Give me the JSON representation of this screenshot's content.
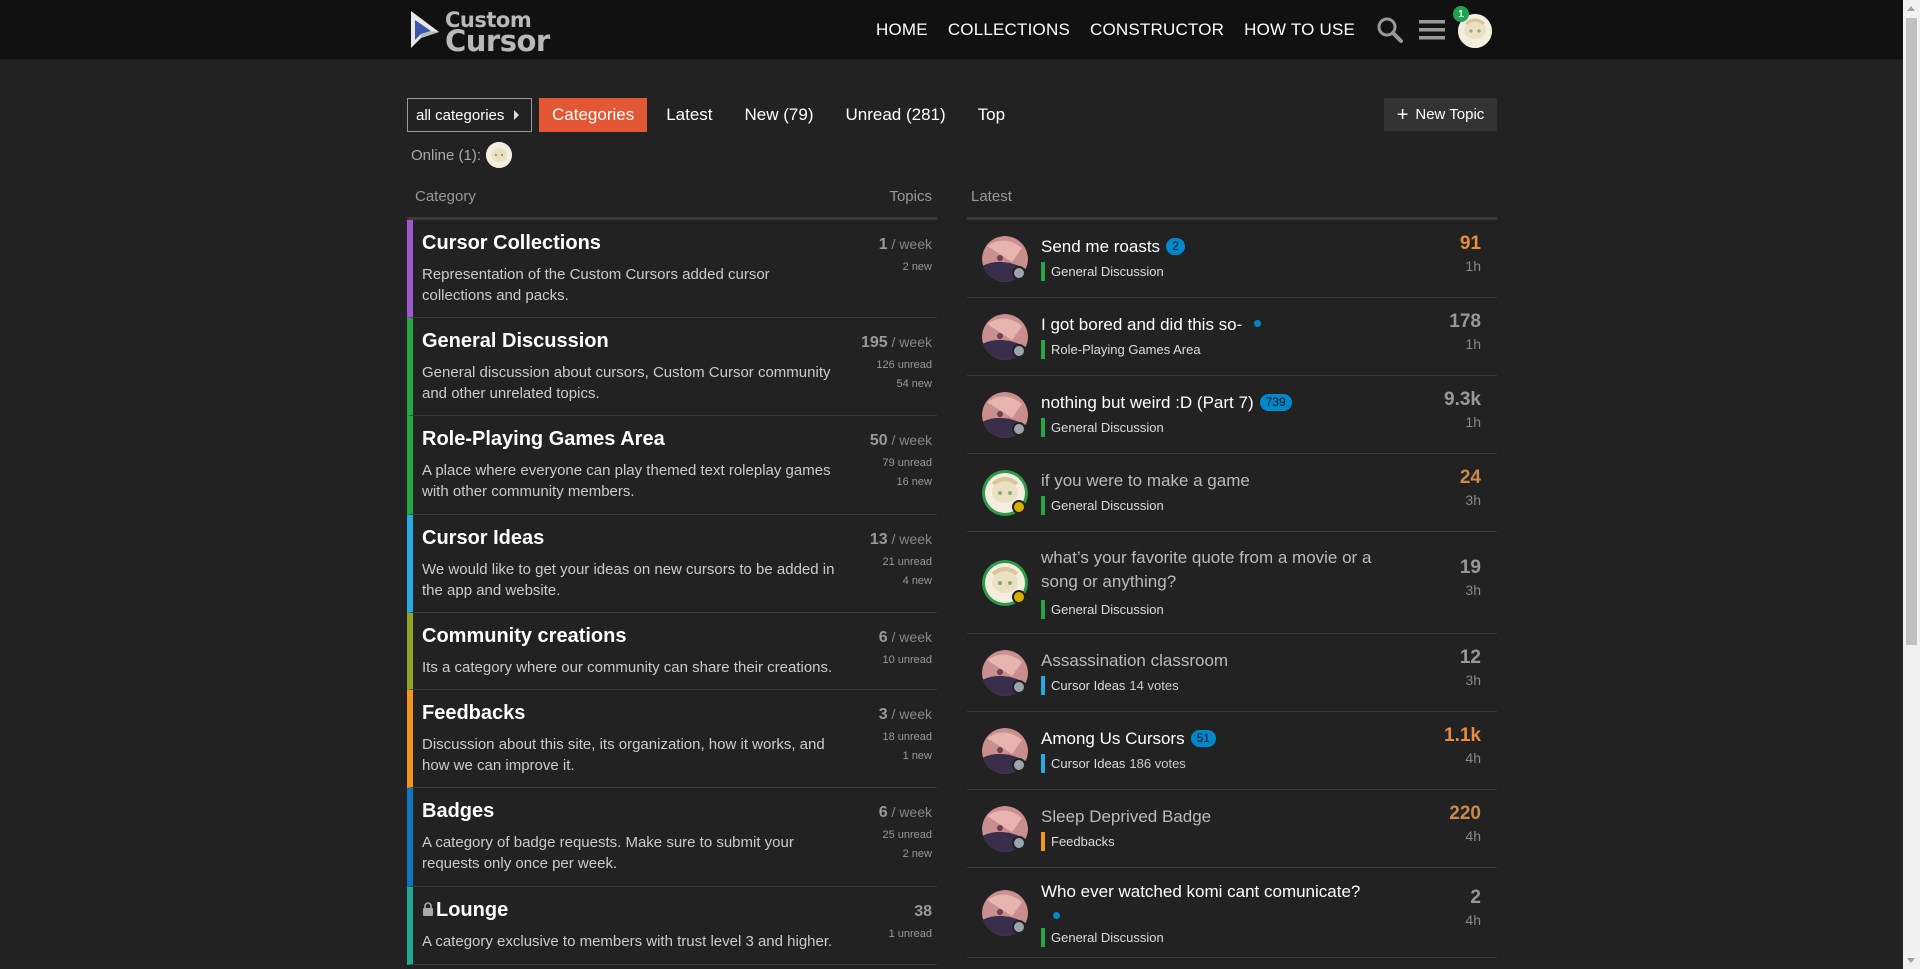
{
  "header": {
    "logo_alt": "Custom Cursor",
    "nav": [
      "HOME",
      "COLLECTIONS",
      "CONSTRUCTOR",
      "HOW TO USE"
    ],
    "notification_count": "1"
  },
  "toolbar": {
    "dropdown_label": "all categories",
    "tabs": [
      "Categories",
      "Latest",
      "New (79)",
      "Unread (281)",
      "Top"
    ],
    "new_topic_label": "New Topic"
  },
  "online_label": "Online (1):",
  "categories_header": {
    "category": "Category",
    "topics": "Topics"
  },
  "latest_header": "Latest",
  "categories": [
    {
      "name": "Cursor Collections",
      "description": "Representation of the Custom Cursors added cursor collections and packs.",
      "count": "1",
      "period": " / week",
      "sub1": "2 new",
      "sub2": "",
      "color": "#9e58ce",
      "locked": false
    },
    {
      "name": "General Discussion",
      "description": "General discussion about cursors, Custom Cursor community and other unrelated topics.",
      "count": "195",
      "period": " / week",
      "sub1": "126 unread",
      "sub2": "54 new",
      "color": "#27a744",
      "locked": false
    },
    {
      "name": "Role-Playing Games Area",
      "description": "A place where everyone can play themed text roleplay games with other community members.",
      "count": "50",
      "period": " / week",
      "sub1": "79 unread",
      "sub2": "16 new",
      "color": "#27a744",
      "locked": false
    },
    {
      "name": "Cursor Ideas",
      "description": "We would like to get your ideas on new cursors to be added in the app and website.",
      "count": "13",
      "period": " / week",
      "sub1": "21 unread",
      "sub2": "4 new",
      "color": "#25aae1",
      "locked": false
    },
    {
      "name": "Community creations",
      "description": "Its a category where our community can share their creations.",
      "count": "6",
      "period": " / week",
      "sub1": "10 unread",
      "sub2": "",
      "color": "#92a32a",
      "locked": false
    },
    {
      "name": "Feedbacks",
      "description": "Discussion about this site, its organization, how it works, and how we can improve it.",
      "count": "3",
      "period": " / week",
      "sub1": "18 unread",
      "sub2": "1 new",
      "color": "#f7941d",
      "locked": false
    },
    {
      "name": "Badges",
      "description": "A category of badge requests. Make sure to submit your requests only once per week.",
      "count": "6",
      "period": " / week",
      "sub1": "25 unread",
      "sub2": "2 new",
      "color": "#0e76bd",
      "locked": false
    },
    {
      "name": "Lounge",
      "description": "A category exclusive to members with trust level 3 and higher.",
      "count": "38",
      "period": "",
      "sub1": "1 unread",
      "sub2": "",
      "color": "#1fa98e",
      "locked": true
    }
  ],
  "topics": [
    {
      "title": "Send me roasts",
      "badge": "2",
      "dot": false,
      "read": false,
      "category": "General Discussion",
      "cat_color": "#27a744",
      "votes": "",
      "replies": "91",
      "replies_color": "#e68d3e",
      "age": "1h",
      "avatar": "pink"
    },
    {
      "title": "I got bored and did this so-",
      "badge": "",
      "dot": true,
      "read": false,
      "category": "Role-Playing Games Area",
      "cat_color": "#27a744",
      "votes": "",
      "replies": "178",
      "replies_color": "#999999",
      "age": "1h",
      "avatar": "pink"
    },
    {
      "title": "nothing but weird :D (Part 7)",
      "badge": "739",
      "dot": false,
      "read": false,
      "category": "General Discussion",
      "cat_color": "#27a744",
      "votes": "",
      "replies": "9.3k",
      "replies_color": "#999999",
      "age": "1h",
      "avatar": "pink"
    },
    {
      "title": "if you were to make a game",
      "badge": "",
      "dot": false,
      "read": true,
      "category": "General Discussion",
      "cat_color": "#27a744",
      "votes": "",
      "replies": "24",
      "replies_color": "#c98a4a",
      "age": "3h",
      "avatar": "cream"
    },
    {
      "title": "what’s your favorite quote from a movie or a song or anything?",
      "badge": "",
      "dot": false,
      "read": true,
      "category": "General Discussion",
      "cat_color": "#27a744",
      "votes": "",
      "replies": "19",
      "replies_color": "#999999",
      "age": "3h",
      "avatar": "cream"
    },
    {
      "title": "Assassination classroom",
      "badge": "",
      "dot": false,
      "read": true,
      "category": "Cursor Ideas",
      "cat_color": "#25aae1",
      "votes": "14 votes",
      "replies": "12",
      "replies_color": "#999999",
      "age": "3h",
      "avatar": "pink"
    },
    {
      "title": "Among Us Cursors",
      "badge": "51",
      "dot": false,
      "read": false,
      "category": "Cursor Ideas",
      "cat_color": "#25aae1",
      "votes": "186 votes",
      "replies": "1.1k",
      "replies_color": "#e68d3e",
      "age": "4h",
      "avatar": "pink"
    },
    {
      "title": "Sleep Deprived Badge",
      "badge": "",
      "dot": false,
      "read": true,
      "category": "Feedbacks",
      "cat_color": "#f7941d",
      "votes": "",
      "replies": "220",
      "replies_color": "#c98a4a",
      "age": "4h",
      "avatar": "pink"
    },
    {
      "title": "Who ever watched komi cant comunicate?",
      "badge": "",
      "dot": true,
      "read": false,
      "category": "General Discussion",
      "cat_color": "#27a744",
      "votes": "",
      "replies": "2",
      "replies_color": "#999999",
      "age": "4h",
      "avatar": "pink"
    }
  ]
}
